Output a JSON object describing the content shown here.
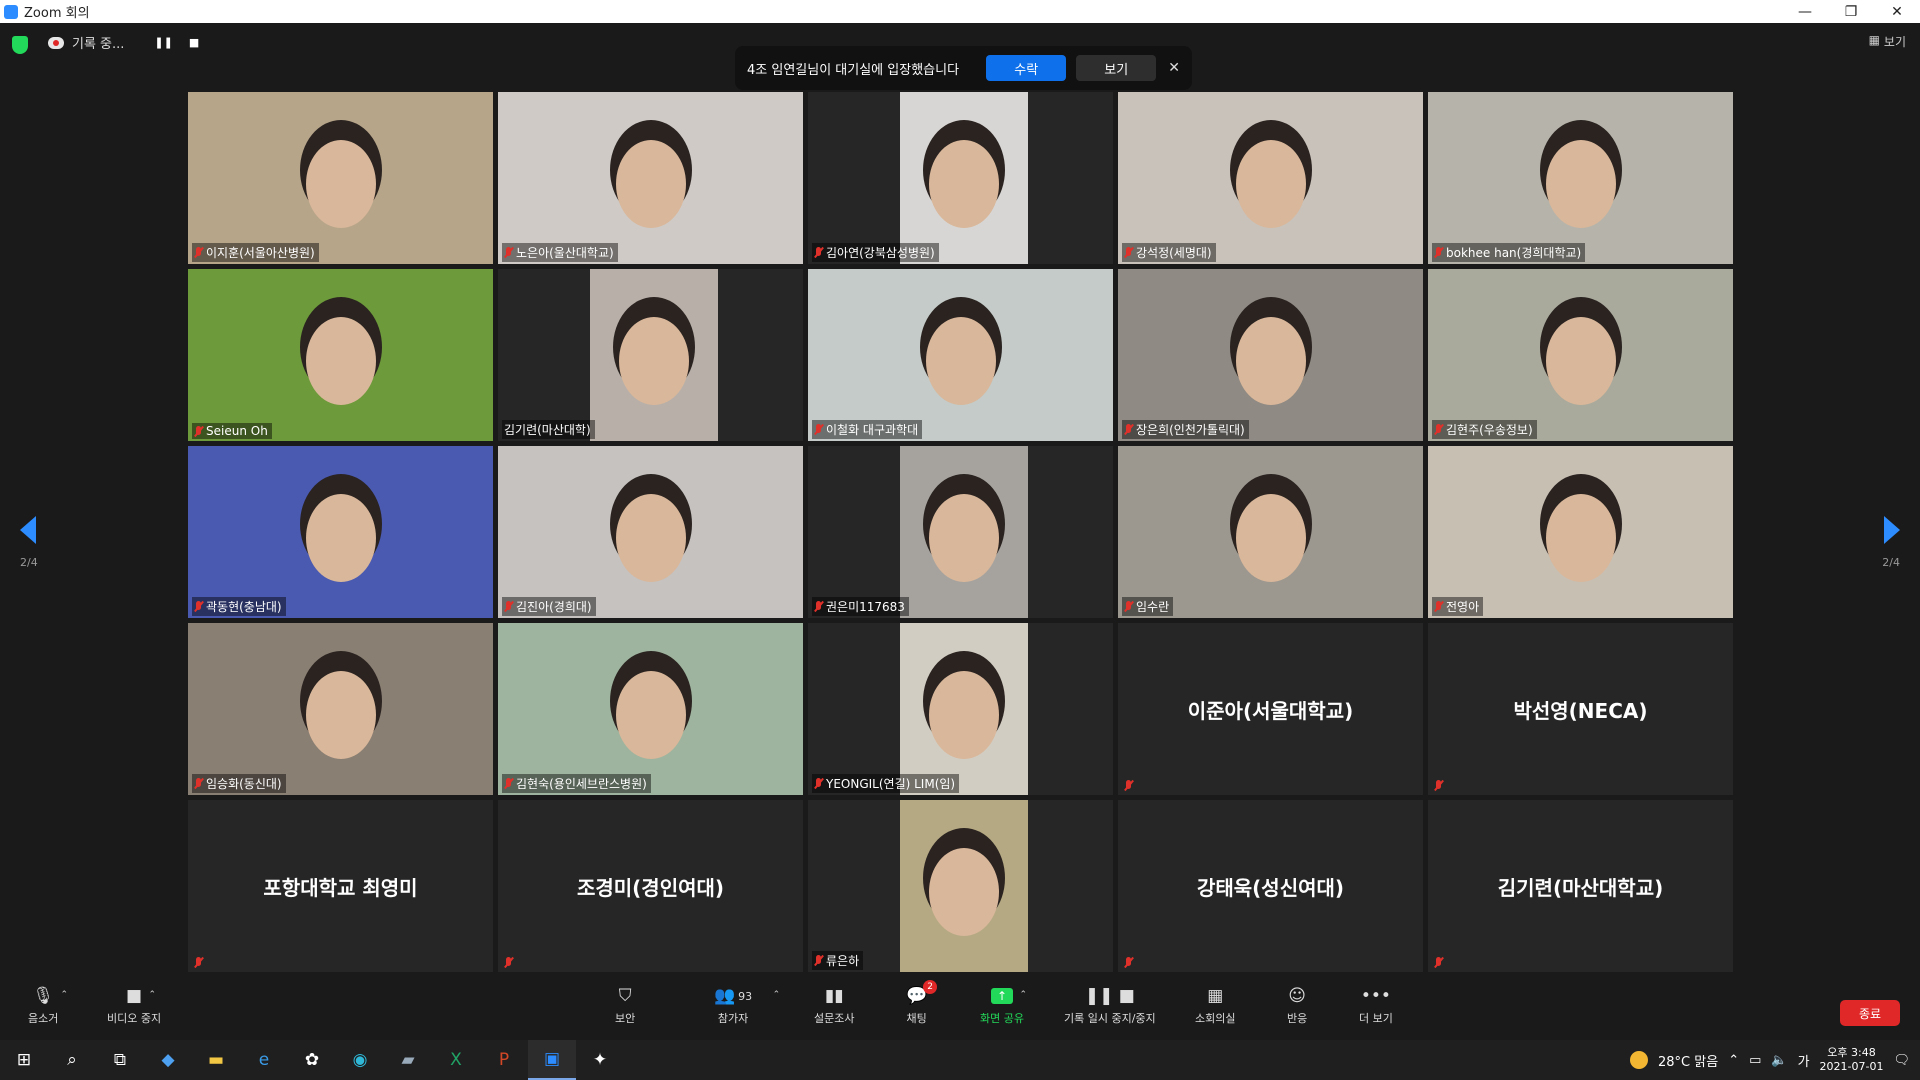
{
  "window": {
    "title": "Zoom 회의",
    "controls": [
      "—",
      "❐",
      "✕"
    ]
  },
  "topbar": {
    "recording_text": "기록 중...",
    "pause": "❚❚",
    "stop": "■",
    "view_label": "보기"
  },
  "notification": {
    "message": "4조 임연길님이 대기실에 입장했습니다",
    "accept": "수락",
    "view": "보기",
    "close": "✕"
  },
  "pagination": {
    "left": "2/4",
    "right": "2/4"
  },
  "tiles": [
    {
      "name": "이지훈(서울아산병원)",
      "video": true,
      "bg": "#b7a58a"
    },
    {
      "name": "노은아(울산대학교)",
      "video": true,
      "bg": "#cfcac6"
    },
    {
      "name": "김아연(강북삼성병원)",
      "video": true,
      "bg": "#d8d6d4"
    },
    {
      "name": "강석정(세명대)",
      "video": true,
      "bg": "#c9c2ba"
    },
    {
      "name": "bokhee han(경희대학교)",
      "video": true,
      "bg": "#b6b4aa"
    },
    {
      "name": "Seieun Oh",
      "video": true,
      "bg": "#6d9a3a"
    },
    {
      "name": "김기련(마산대학)",
      "video": true,
      "bg": "#b8b0a8"
    },
    {
      "name": "이철화 대구과학대",
      "video": true,
      "bg": "#c4cbc8"
    },
    {
      "name": "장은희(인천가톨릭대)",
      "video": true,
      "bg": "#8f8a83"
    },
    {
      "name": "김현주(우송정보)",
      "video": true,
      "bg": "#a9aa9c"
    },
    {
      "name": "곽동현(충남대)",
      "video": true,
      "bg": "#4a5ab0"
    },
    {
      "name": "김진아(경희대)",
      "video": true,
      "bg": "#c5c2c0"
    },
    {
      "name": "권은미117683",
      "video": true,
      "bg": "#a6a39f"
    },
    {
      "name": "임수란",
      "video": true,
      "bg": "#9c978f"
    },
    {
      "name": "전영아",
      "video": true,
      "bg": "#c8bfb3"
    },
    {
      "name": "임승화(동신대)",
      "video": true,
      "bg": "#8a7f73"
    },
    {
      "name": "김현숙(용인세브란스병원)",
      "video": true,
      "bg": "#9fb49e"
    },
    {
      "name": "YEONGIL(연길) LIM(임)",
      "video": true,
      "bg": "#d2cdc2"
    },
    {
      "name": "이준아(서울대학교)",
      "video": false
    },
    {
      "name": "박선영(NECA)",
      "video": false
    },
    {
      "name": "포항대학교 최영미",
      "video": false
    },
    {
      "name": "조경미(경인여대)",
      "video": false
    },
    {
      "name": "류은하",
      "video": true,
      "bg": "#b5a983"
    },
    {
      "name": "강태욱(성신여대)",
      "video": false
    },
    {
      "name": "김기련(마산대학교)",
      "video": false
    }
  ],
  "toolbar": {
    "mute": "음소거",
    "stop_video": "비디오 중지",
    "security": "보안",
    "participants": "참가자",
    "participants_count": "93",
    "polls": "설문조사",
    "chat": "채팅",
    "chat_badge": "2",
    "share": "화면 공유",
    "pause_record": "기록 일시 중지/중지",
    "breakout": "소회의실",
    "reactions": "반응",
    "more": "더 보기",
    "end": "종료"
  },
  "taskbar": {
    "weather": "28°C  맑음",
    "ime": "가",
    "time": "오후 3:48",
    "date": "2021-07-01"
  },
  "colors": {
    "accent": "#0e71eb",
    "end_red": "#e02828",
    "share_green": "#23d959"
  }
}
